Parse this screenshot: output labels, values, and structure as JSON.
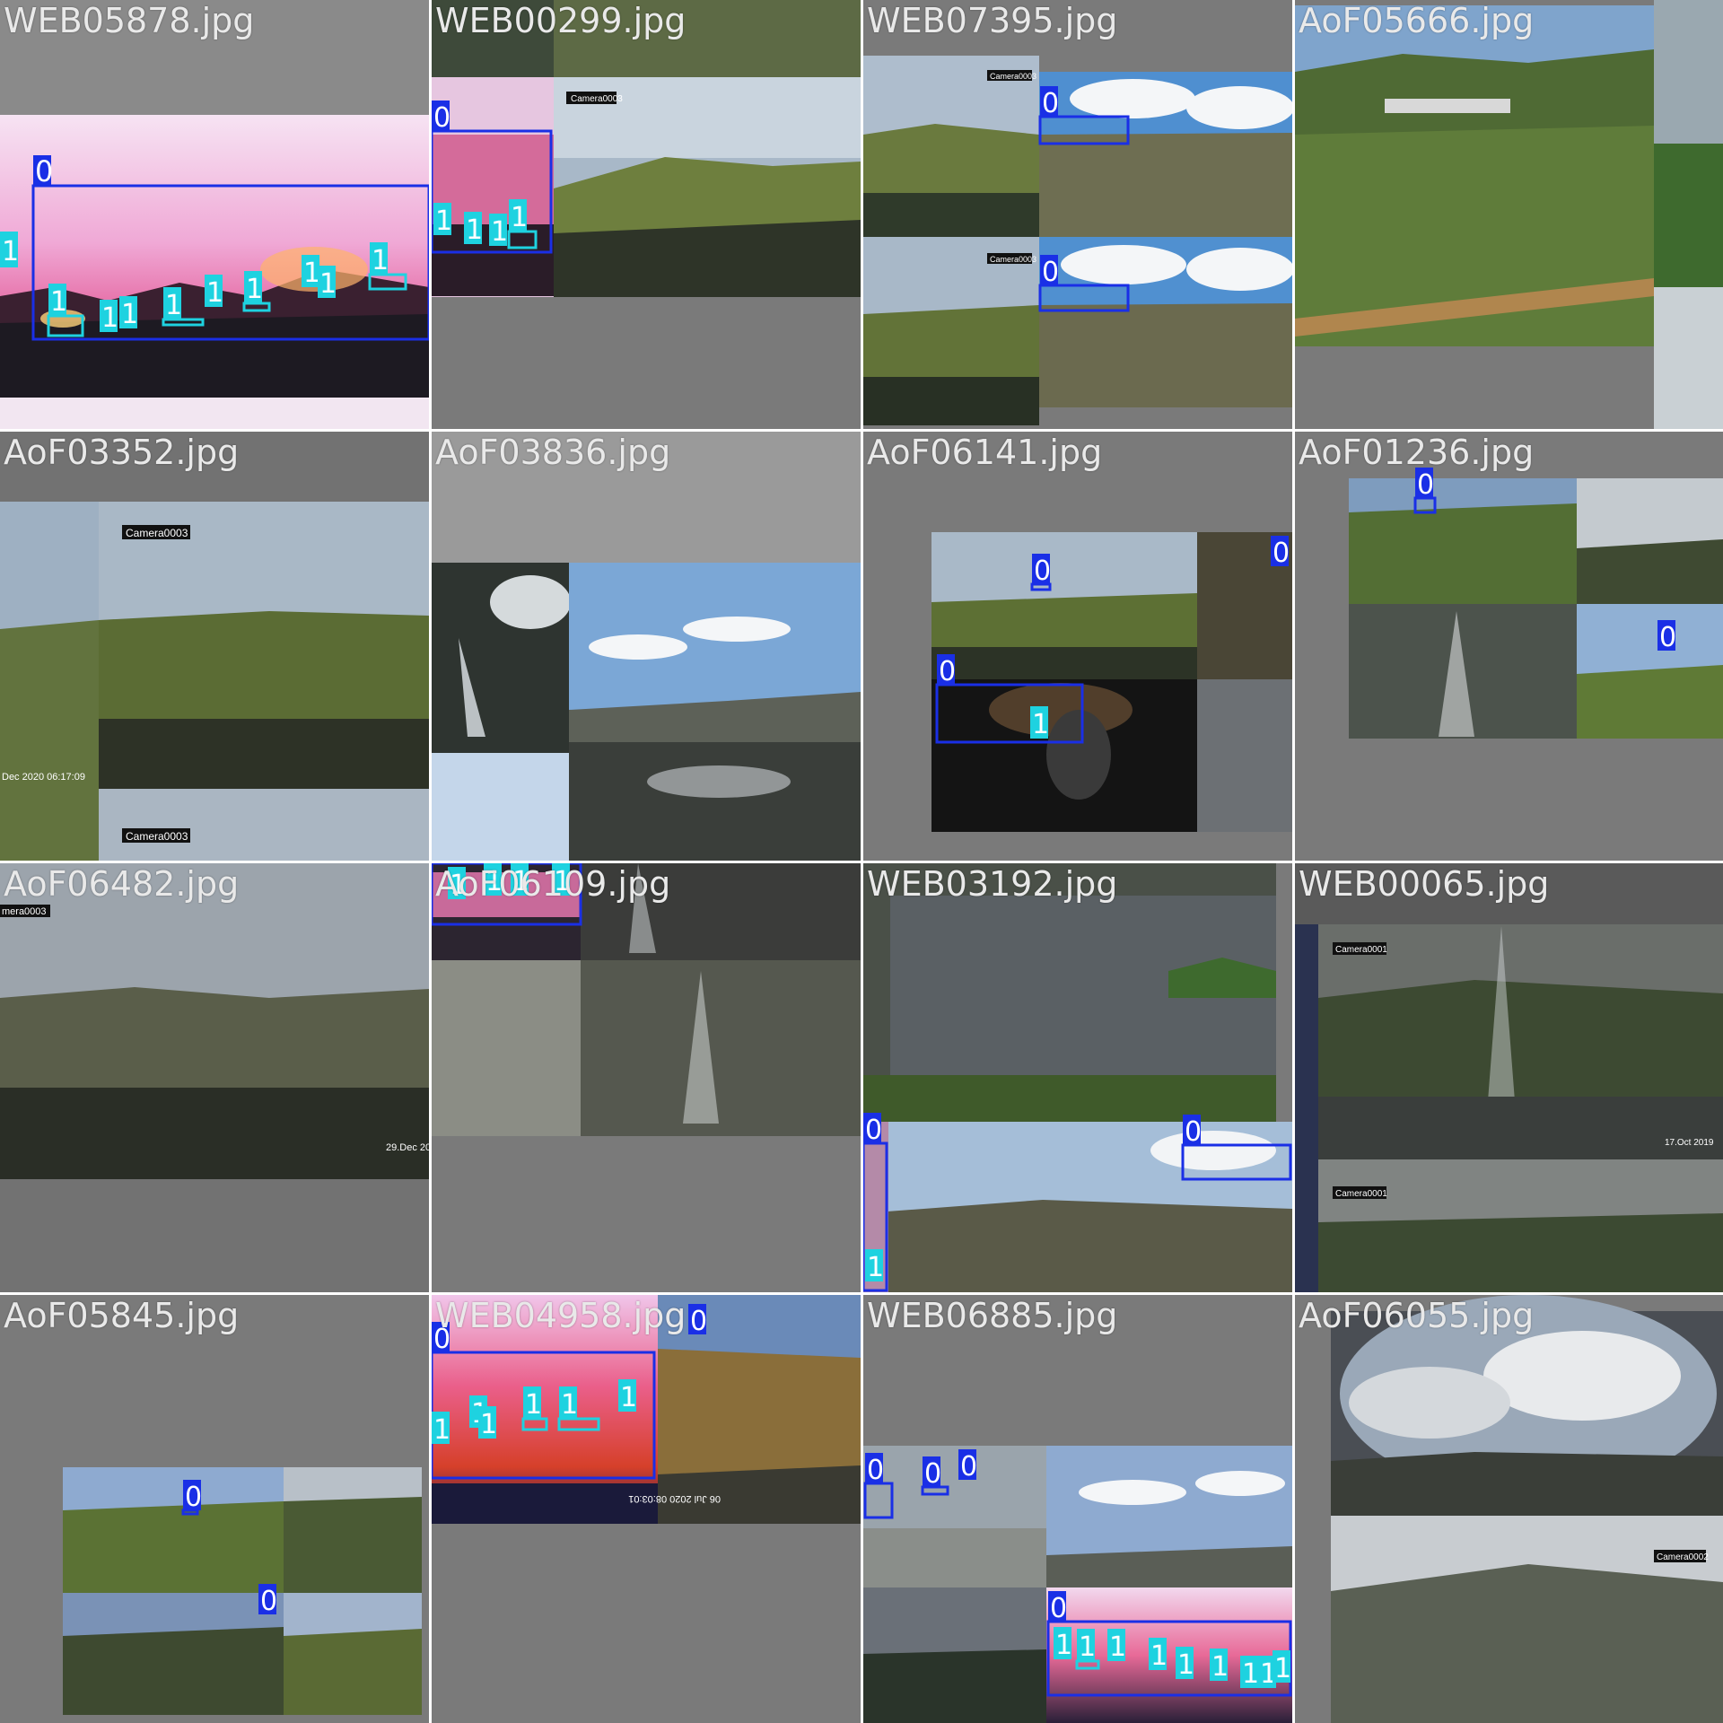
{
  "mosaic": {
    "tiles": [
      {
        "filename": "WEB05878.jpg",
        "boxes": [
          "0",
          "1",
          "1",
          "1",
          "1",
          "1",
          "1",
          "1",
          "1",
          "1",
          "1"
        ]
      },
      {
        "filename": "WEB00299.jpg",
        "boxes": [
          "0",
          "1",
          "1",
          "1",
          "1"
        ],
        "overlay_text": [
          "Camera0003"
        ]
      },
      {
        "filename": "WEB07395.jpg",
        "boxes": [
          "0",
          "0"
        ],
        "overlay_text": [
          "Camera0003",
          "Camera0003"
        ]
      },
      {
        "filename": "AoF05666.jpg",
        "boxes": []
      },
      {
        "filename": "AoF03352.jpg",
        "boxes": [],
        "overlay_text": [
          "Camera0003",
          "Camera0003",
          "Dec 2020 06:17:09"
        ]
      },
      {
        "filename": "AoF03836.jpg",
        "boxes": []
      },
      {
        "filename": "AoF06141.jpg",
        "boxes": [
          "0",
          "0",
          "0",
          "1"
        ]
      },
      {
        "filename": "AoF01236.jpg",
        "boxes": [
          "0",
          "0"
        ]
      },
      {
        "filename": "AoF06482.jpg",
        "boxes": [],
        "overlay_text": [
          "mera0003",
          "29.Dec 20"
        ]
      },
      {
        "filename": "AoF06109.jpg",
        "boxes": [
          "0",
          "1",
          "1",
          "1",
          "1"
        ]
      },
      {
        "filename": "WEB03192.jpg",
        "boxes": [
          "0",
          "0",
          "1"
        ]
      },
      {
        "filename": "WEB00065.jpg",
        "boxes": [],
        "overlay_text": [
          "Camera0001",
          "Camera0001",
          "17.Oct 2019"
        ]
      },
      {
        "filename": "AoF05845.jpg",
        "boxes": [
          "0",
          "0"
        ]
      },
      {
        "filename": "WEB04958.jpg",
        "boxes": [
          "0",
          "0",
          "1",
          "1",
          "1",
          "1",
          "1",
          "1"
        ]
      },
      {
        "filename": "WEB06885.jpg",
        "boxes": [
          "0",
          "0",
          "0",
          "0",
          "1",
          "1",
          "1",
          "1",
          "1",
          "1",
          "1",
          "1",
          "1"
        ]
      },
      {
        "filename": "AoF06055.jpg",
        "boxes": [],
        "overlay_text": [
          "Camera0002"
        ]
      }
    ]
  },
  "colors": {
    "class_0_box": "#1a2fe6",
    "class_1_box": "#1ed2e0",
    "label_text": "#ffffff",
    "pad_gray": "#7a7a7a"
  }
}
